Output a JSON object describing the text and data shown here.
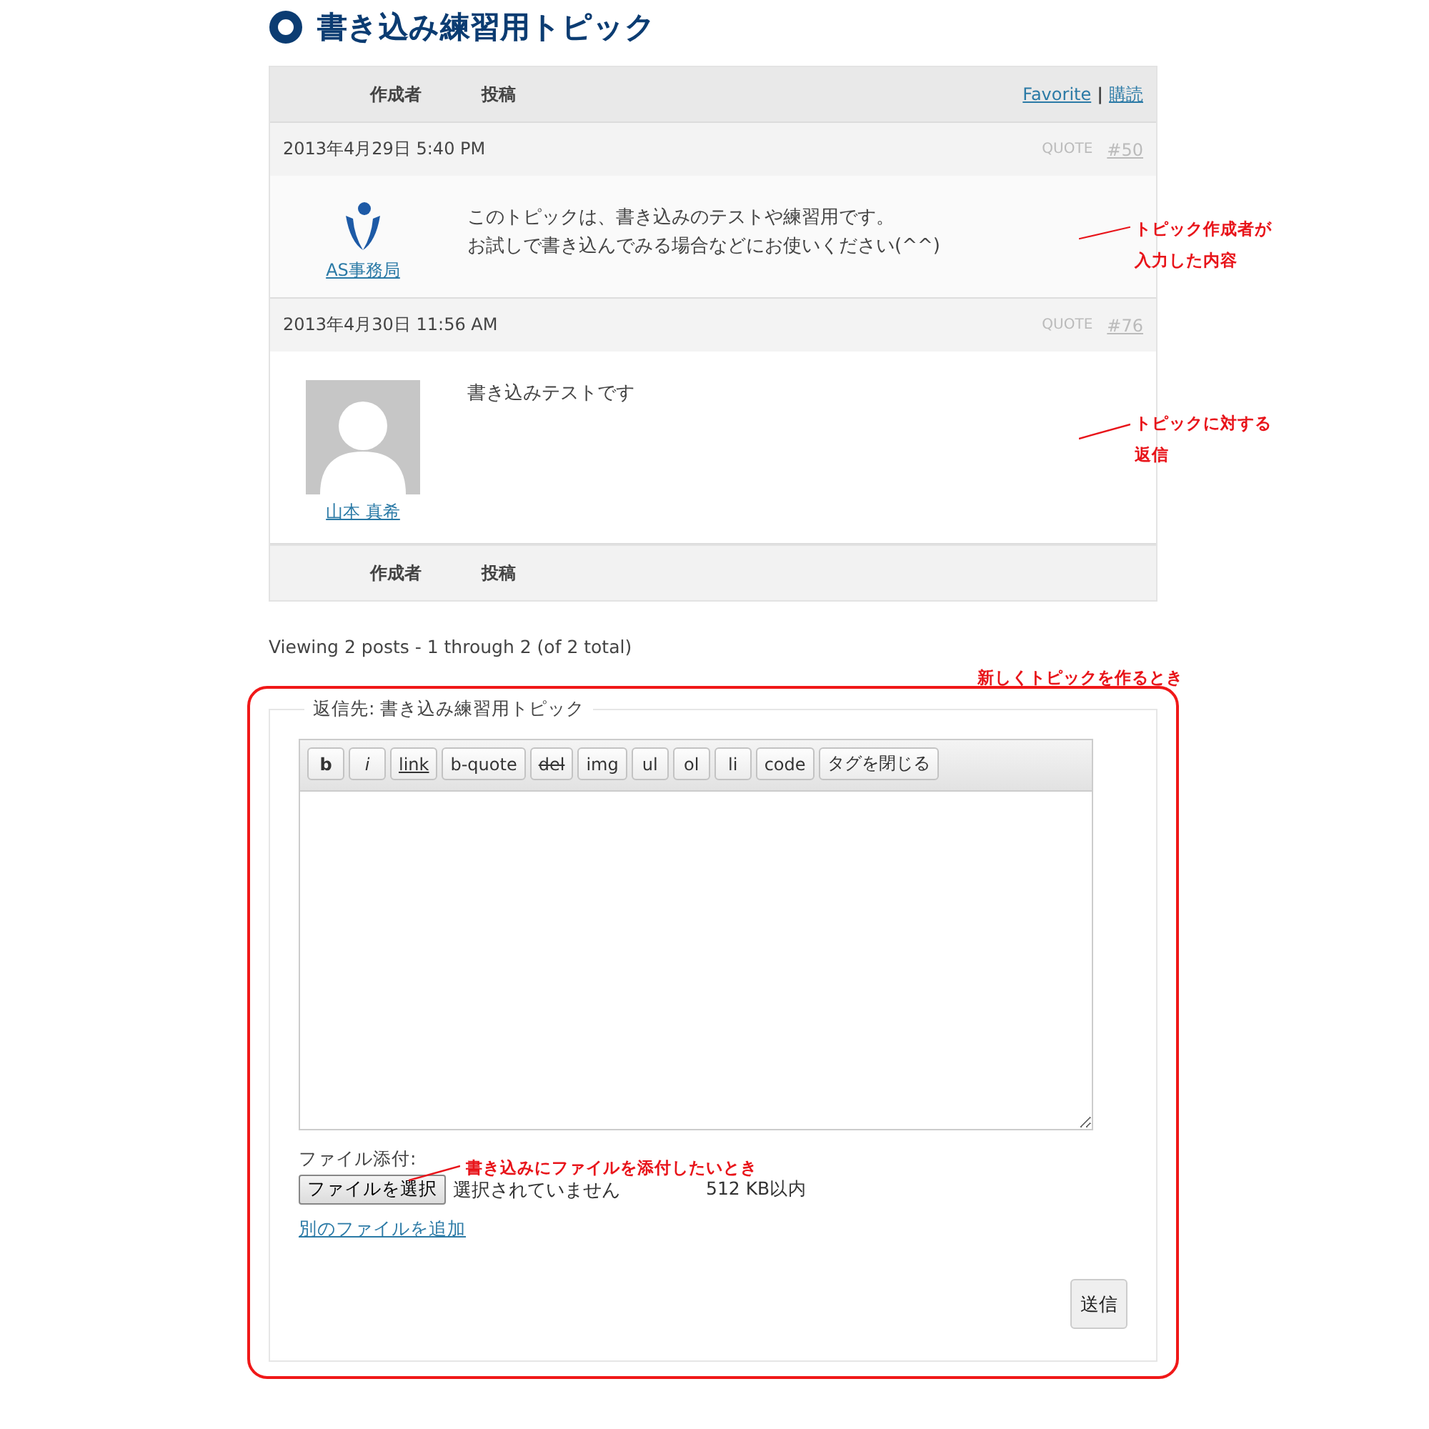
{
  "title": "書き込み練習用トピック",
  "table": {
    "columns": [
      "作成者",
      "投稿"
    ],
    "links": [
      {
        "label": "Favorite"
      },
      {
        "label": "購読"
      }
    ],
    "separator": "|"
  },
  "posts": [
    {
      "date": "2013年4月29日 5:40 PM",
      "quote": "QUOTE",
      "number": "#50",
      "author": "AS事務局",
      "avatar": {
        "kind": "logo"
      },
      "lines": [
        "このトピックは、書き込みのテストや練習用です。",
        "お試しで書き込んでみる場合などにお使いください(^^)"
      ]
    },
    {
      "date": "2013年4月30日 11:56 AM",
      "quote": "QUOTE",
      "number": "#76",
      "author": "山本 真希",
      "avatar": {
        "kind": "silhouette"
      },
      "lines": [
        "書き込みテストです"
      ]
    }
  ],
  "footer_columns": [
    "作成者",
    "投稿"
  ],
  "pagination": "Viewing 2 posts - 1 through 2 (of 2 total)",
  "reply_form": {
    "legend": "返信先: 書き込み練習用トピック",
    "toolbar": [
      {
        "label": "b",
        "kind": "bold"
      },
      {
        "label": "i",
        "kind": "italic"
      },
      {
        "label": "link",
        "kind": "underline"
      },
      {
        "label": "b-quote",
        "kind": "plain"
      },
      {
        "label": "del",
        "kind": "strike"
      },
      {
        "label": "img",
        "kind": "plain"
      },
      {
        "label": "ul",
        "kind": "plain"
      },
      {
        "label": "ol",
        "kind": "plain"
      },
      {
        "label": "li",
        "kind": "plain"
      },
      {
        "label": "code",
        "kind": "plain"
      },
      {
        "label": "タグを閉じる",
        "kind": "plain"
      }
    ],
    "file_label": "ファイル添付:",
    "choose_button": "ファイルを選択",
    "no_file": "選択されていません",
    "size_limit": "512 KB以内",
    "add_file_link": "別のファイルを追加",
    "submit": "送信"
  },
  "annotations": [
    {
      "lines": [
        "トピック作成者が",
        "入力した内容"
      ]
    },
    {
      "lines": [
        "トピックに対する",
        "返信"
      ]
    },
    {
      "lines": [
        "新しくトピックを作るとき"
      ]
    },
    {
      "lines": [
        "書き込みにファイルを添付したいとき"
      ]
    }
  ]
}
